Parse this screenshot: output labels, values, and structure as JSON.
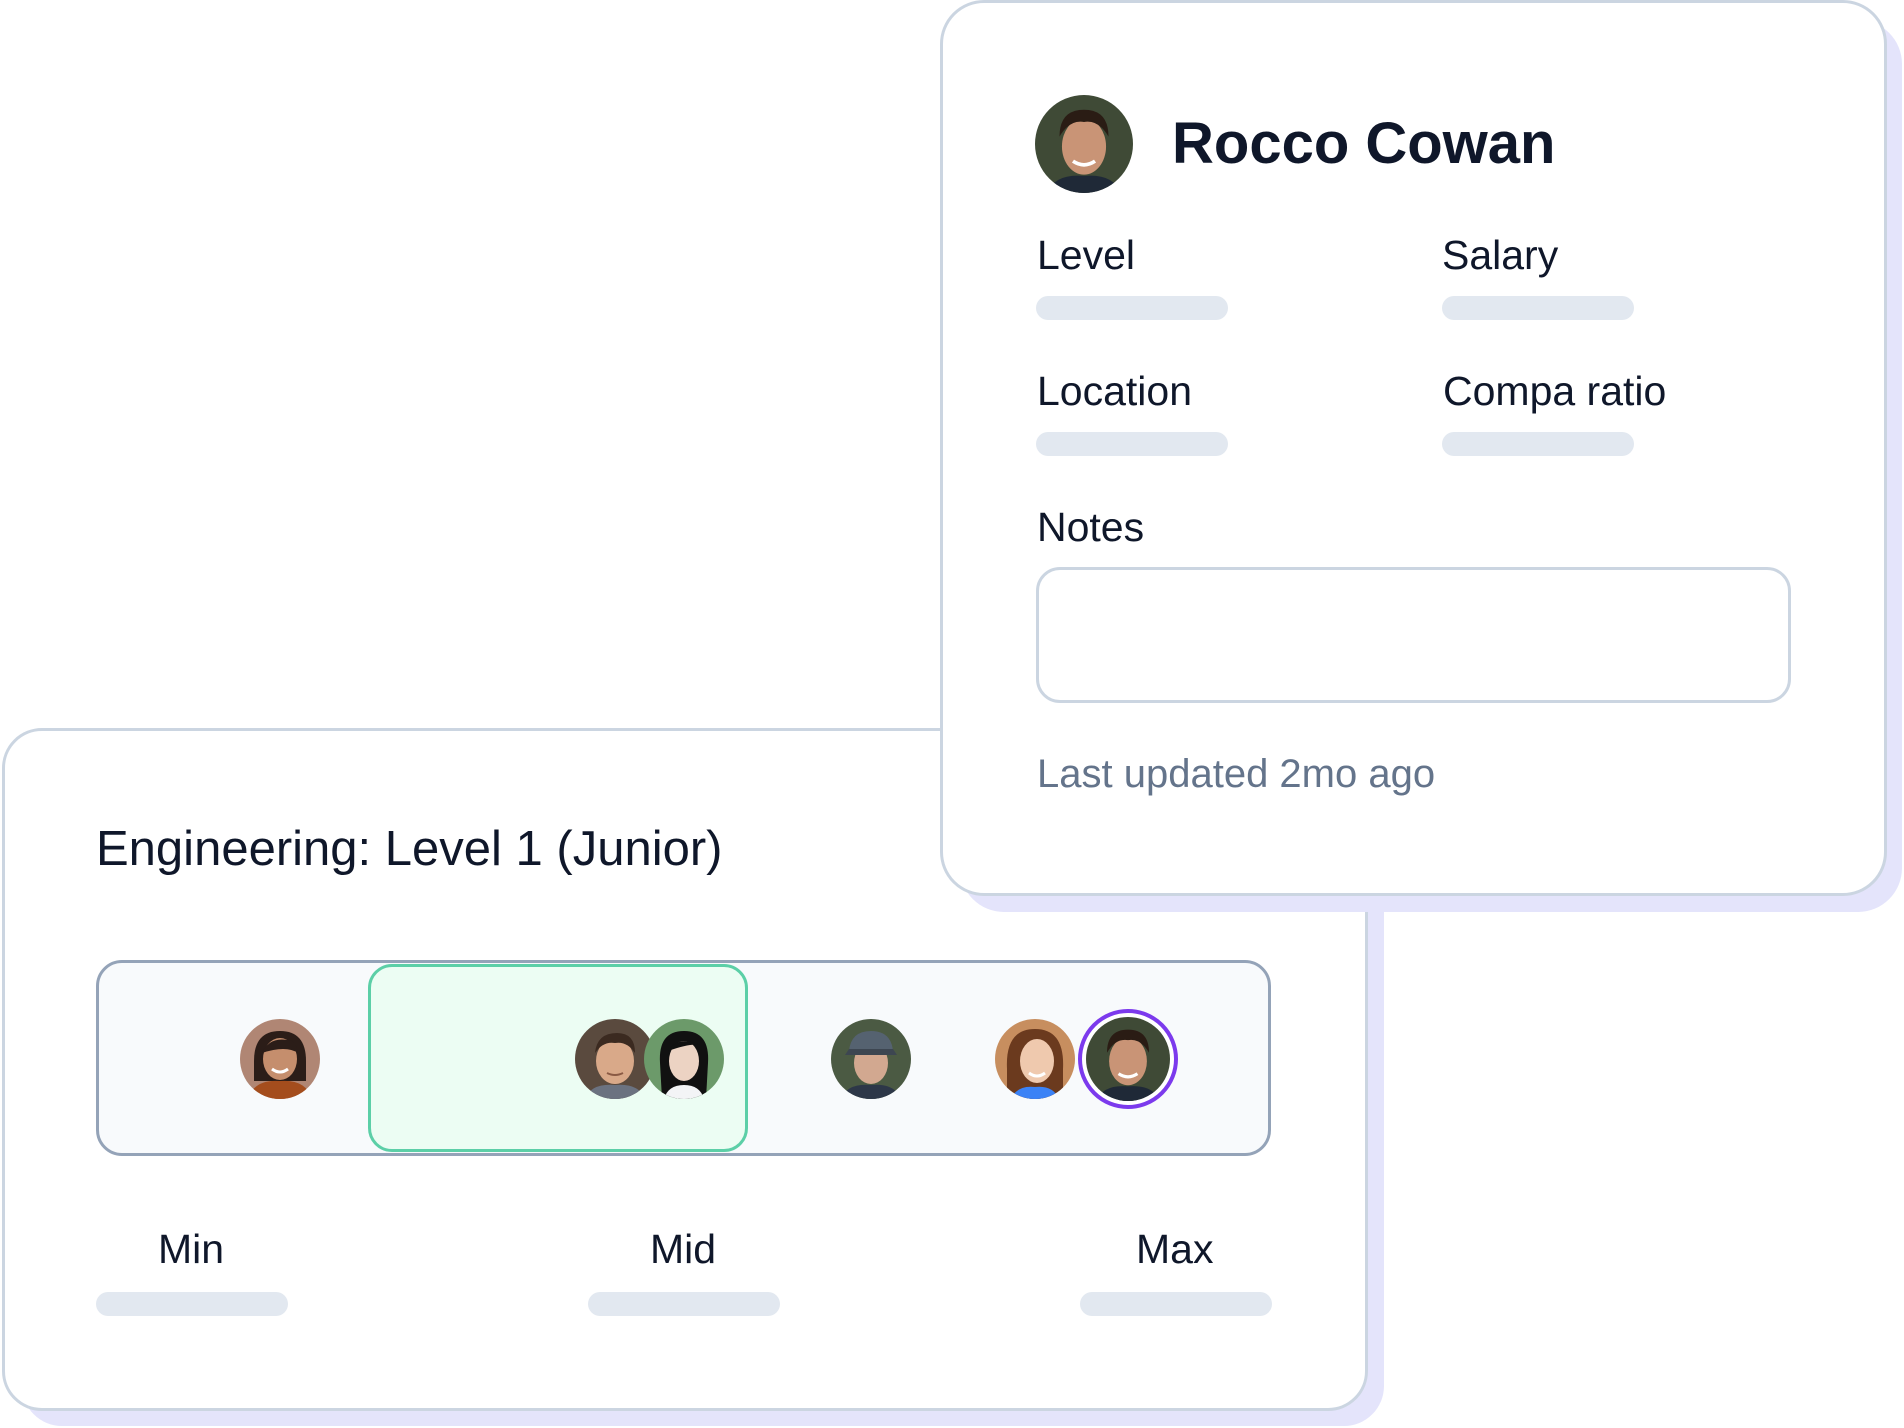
{
  "band": {
    "title": "Engineering: Level 1 (Junior)",
    "scale": {
      "min_label": "Min",
      "mid_label": "Mid",
      "max_label": "Max"
    },
    "range_color": "#ecfdf3",
    "highlight_color": "#7c3aed"
  },
  "employee": {
    "name": "Rocco Cowan",
    "fields": {
      "level_label": "Level",
      "salary_label": "Salary",
      "location_label": "Location",
      "compa_ratio_label": "Compa ratio",
      "notes_label": "Notes"
    },
    "notes_value": "",
    "last_updated": "Last updated 2mo ago"
  }
}
